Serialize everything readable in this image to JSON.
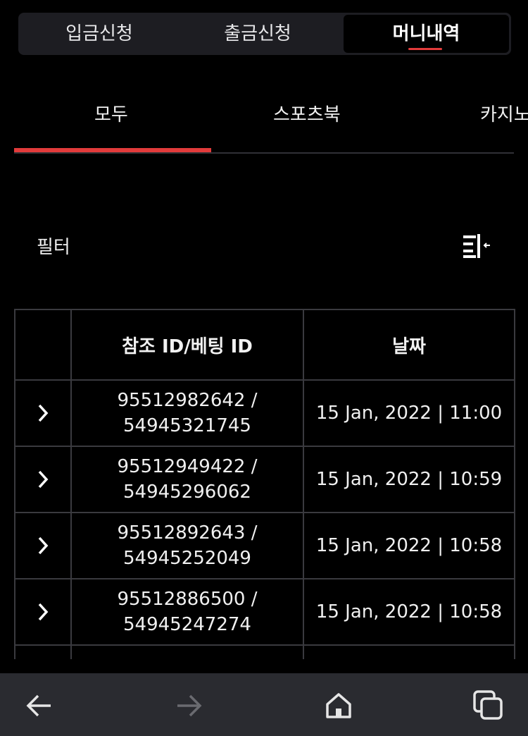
{
  "segments": [
    {
      "label": "입금신청",
      "active": false
    },
    {
      "label": "출금신청",
      "active": false
    },
    {
      "label": "머니내역",
      "active": true
    }
  ],
  "subtabs": [
    {
      "label": "모두",
      "active": true
    },
    {
      "label": "스포츠북",
      "active": false
    },
    {
      "label": "카지노",
      "active": false
    }
  ],
  "filter": {
    "label": "필터",
    "icon": "filter-collapse-icon"
  },
  "table": {
    "headers": [
      "",
      "참조 ID/베팅 ID",
      "날짜"
    ],
    "rows": [
      {
        "ref": "95512982642 /",
        "bet": "54945321745",
        "date": "15 Jan, 2022 | 11:00"
      },
      {
        "ref": "95512949422 /",
        "bet": "54945296062",
        "date": "15 Jan, 2022 | 10:59"
      },
      {
        "ref": "95512892643 /",
        "bet": "54945252049",
        "date": "15 Jan, 2022 | 10:58"
      },
      {
        "ref": "95512886500 /",
        "bet": "54945247274",
        "date": "15 Jan, 2022 | 10:58"
      },
      {
        "ref": "",
        "bet": "",
        "date": ""
      }
    ]
  },
  "navbar": {
    "icons": [
      "back-arrow-icon",
      "forward-arrow-icon",
      "home-icon",
      "tabs-icon"
    ]
  },
  "colors": {
    "accent": "#e23b3b",
    "background": "#000000",
    "navbar": "#2a2b30"
  }
}
